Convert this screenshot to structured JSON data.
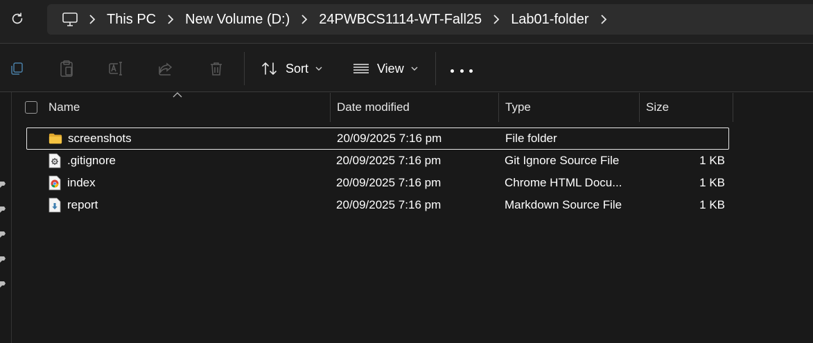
{
  "address_bar": {
    "breadcrumbs": [
      "This PC",
      "New Volume (D:)",
      "24PWBCS1114-WT-Fall25",
      "Lab01-folder"
    ]
  },
  "toolbar": {
    "sort_label": "Sort",
    "view_label": "View"
  },
  "columns": {
    "name": "Name",
    "date_modified": "Date modified",
    "type": "Type",
    "size": "Size"
  },
  "files": [
    {
      "name": "screenshots",
      "date_modified": "20/09/2025 7:16 pm",
      "type": "File folder",
      "size": "",
      "icon": "folder-icon",
      "selected": true
    },
    {
      "name": ".gitignore",
      "date_modified": "20/09/2025 7:16 pm",
      "type": "Git Ignore Source File",
      "size": "1 KB",
      "icon": "settings-file-icon",
      "selected": false
    },
    {
      "name": "index",
      "date_modified": "20/09/2025 7:16 pm",
      "type": "Chrome HTML Docu...",
      "size": "1 KB",
      "icon": "chrome-html-icon",
      "selected": false
    },
    {
      "name": "report",
      "date_modified": "20/09/2025 7:16 pm",
      "type": "Markdown Source File",
      "size": "1 KB",
      "icon": "markdown-file-icon",
      "selected": false
    }
  ],
  "colors": {
    "background": "#191919",
    "toolbar": "#1c1c1c",
    "address_box": "#2d2d2d",
    "folder": "#f5c342",
    "text": "#ffffff"
  }
}
